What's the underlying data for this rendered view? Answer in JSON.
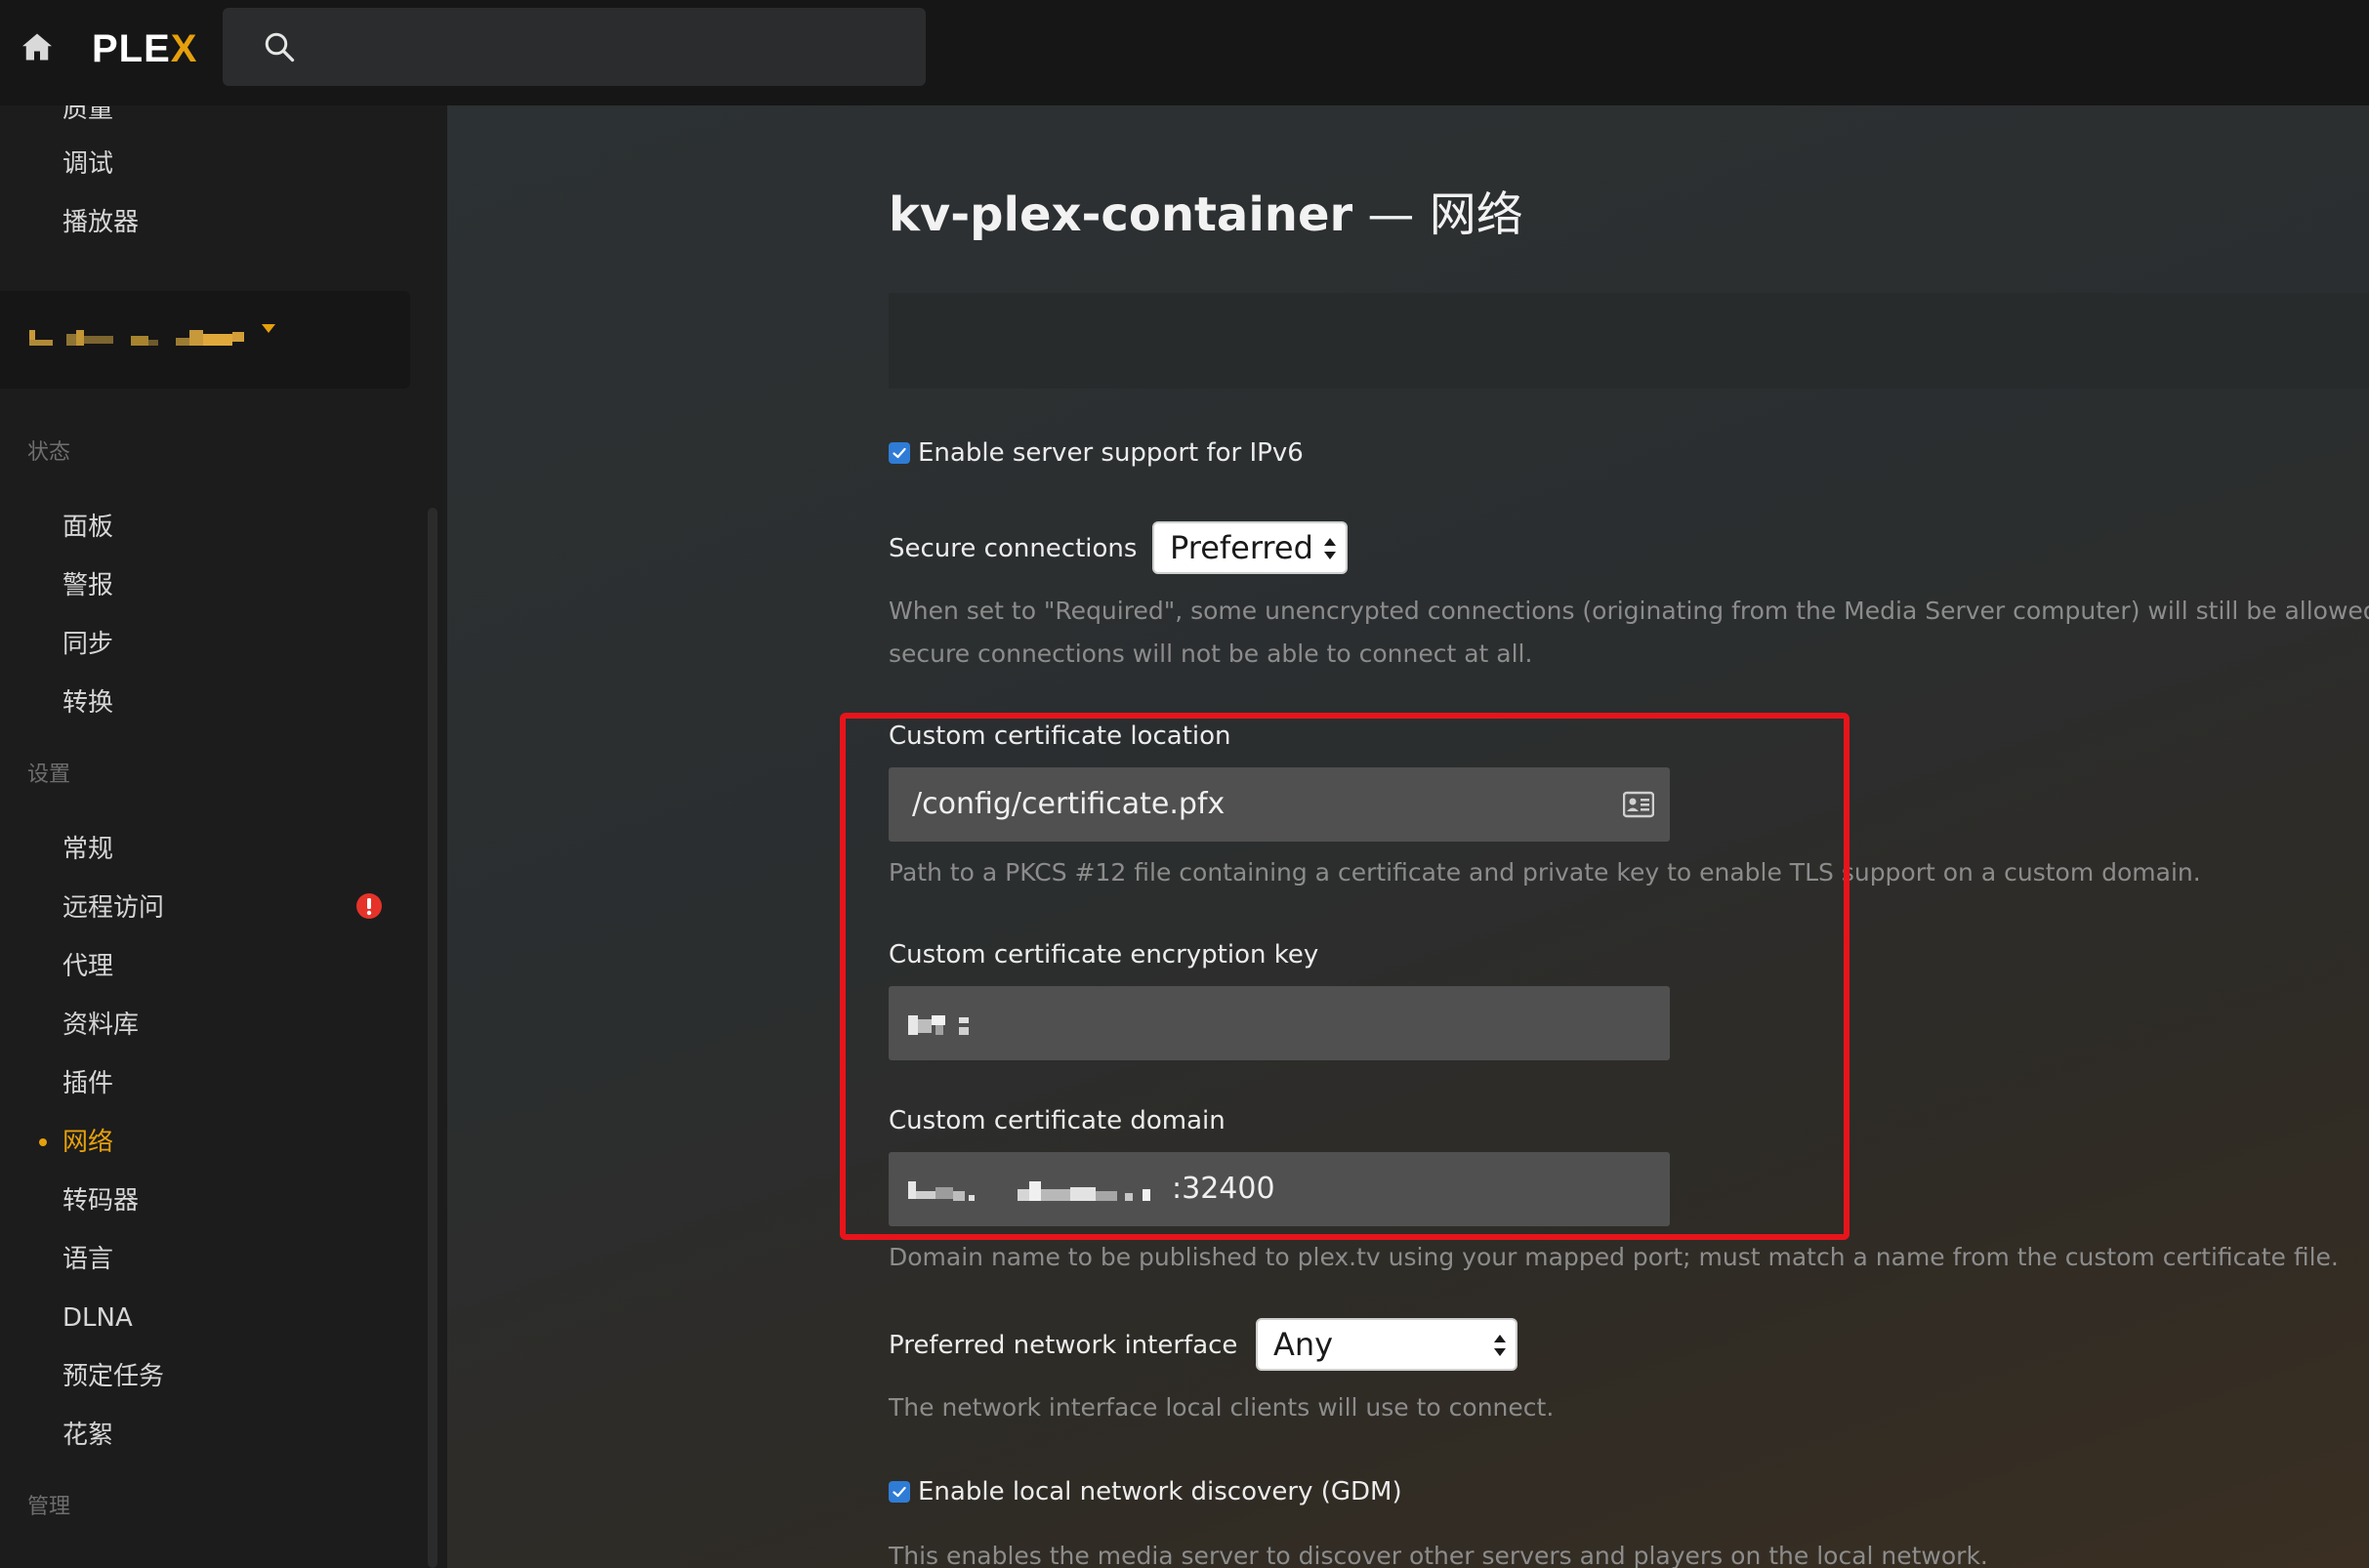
{
  "app": {
    "logo_main": "PLE",
    "logo_accent": "X"
  },
  "search": {
    "placeholder": ""
  },
  "sidebar": {
    "top_items": [
      {
        "label": "质量"
      },
      {
        "label": "调试"
      },
      {
        "label": "播放器"
      }
    ],
    "server_name": "",
    "sections": {
      "status": "状态",
      "settings": "设置",
      "manage": "管理"
    },
    "status_items": [
      {
        "label": "面板"
      },
      {
        "label": "警报"
      },
      {
        "label": "同步"
      },
      {
        "label": "转换"
      }
    ],
    "settings_items": [
      {
        "label": "常规"
      },
      {
        "label": "远程访问"
      },
      {
        "label": "代理"
      },
      {
        "label": "资料库"
      },
      {
        "label": "插件"
      },
      {
        "label": "网络"
      },
      {
        "label": "转码器"
      },
      {
        "label": "语言"
      },
      {
        "label": "DLNA"
      },
      {
        "label": "预定任务"
      },
      {
        "label": "花絮"
      }
    ]
  },
  "main": {
    "title_server": "kv-plex-container",
    "title_sep": " — ",
    "title_section": "网络",
    "ipv6": {
      "label": "Enable server support for IPv6",
      "checked": true
    },
    "secure_connections": {
      "label": "Secure connections",
      "value": "Preferred",
      "help_line1": "When set to \"Required\", some unencrypted connections (originating from the Media Server computer) will still be allowed",
      "help_line2": "secure connections will not be able to connect at all."
    },
    "cert_location": {
      "label": "Custom certificate location",
      "value": "/config/certificate.pfx",
      "help": "Path to a PKCS #12 file containing a certificate and private key to enable TLS support on a custom domain."
    },
    "cert_key": {
      "label": "Custom certificate encryption key",
      "value": ""
    },
    "cert_domain": {
      "label": "Custom certificate domain",
      "value_suffix": ":32400",
      "help": "Domain name to be published to plex.tv using your mapped port; must match a name from the custom certificate file."
    },
    "network_interface": {
      "label": "Preferred network interface",
      "value": "Any",
      "help": "The network interface local clients will use to connect."
    },
    "gdm": {
      "label": "Enable local network discovery (GDM)",
      "checked": true,
      "help": "This enables the media server to discover other servers and players on the local network."
    }
  },
  "colors": {
    "accent": "#e5a00d",
    "checkbox": "#2f7cd6",
    "highlight": "#e8141b",
    "alert": "#e5332a"
  }
}
